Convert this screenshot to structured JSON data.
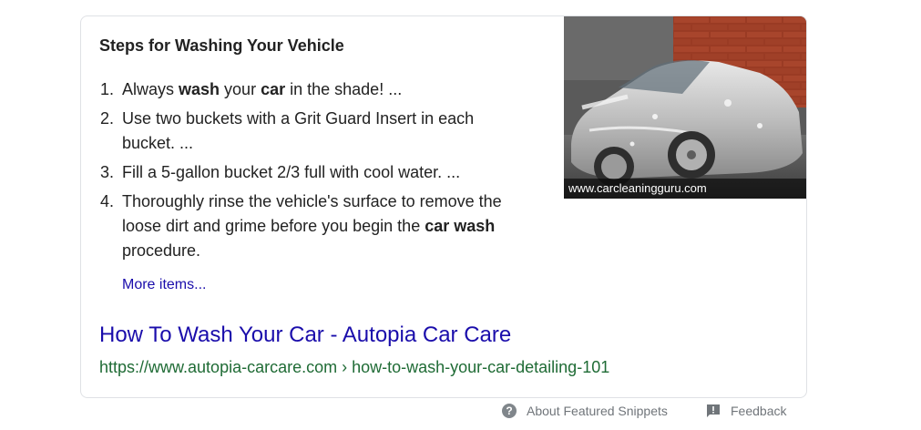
{
  "snippet": {
    "heading": "Steps for Washing Your Vehicle",
    "steps": [
      {
        "num": "1.",
        "parts": [
          [
            "Always ",
            false
          ],
          [
            "wash",
            true
          ],
          [
            " your ",
            false
          ],
          [
            "car",
            true
          ],
          [
            " in the shade! ...",
            false
          ]
        ]
      },
      {
        "num": "2.",
        "parts": [
          [
            "Use two buckets with a Grit Guard Insert in each bucket. ...",
            false
          ]
        ]
      },
      {
        "num": "3.",
        "parts": [
          [
            "Fill a 5-gallon bucket 2/3 full with cool water. ...",
            false
          ]
        ]
      },
      {
        "num": "4.",
        "parts": [
          [
            "Thoroughly rinse the vehicle's surface to remove the loose dirt and grime before you begin the ",
            false
          ],
          [
            "car wash",
            true
          ],
          [
            " procedure.",
            false
          ]
        ]
      }
    ],
    "more_items": "More items...",
    "image_caption": "www.carcleaningguru.com",
    "image_icon": "foamed-car-photo"
  },
  "result": {
    "title": "How To Wash Your Car - Autopia Car Care",
    "url": "https://www.autopia-carcare.com › how-to-wash-your-car-detailing-101"
  },
  "footer": {
    "about_label": "About Featured Snippets",
    "about_icon": "question-icon",
    "feedback_label": "Feedback",
    "feedback_icon": "feedback-icon"
  },
  "colors": {
    "link": "#1a0dab",
    "url": "#1f6b35",
    "muted": "#70757a"
  }
}
